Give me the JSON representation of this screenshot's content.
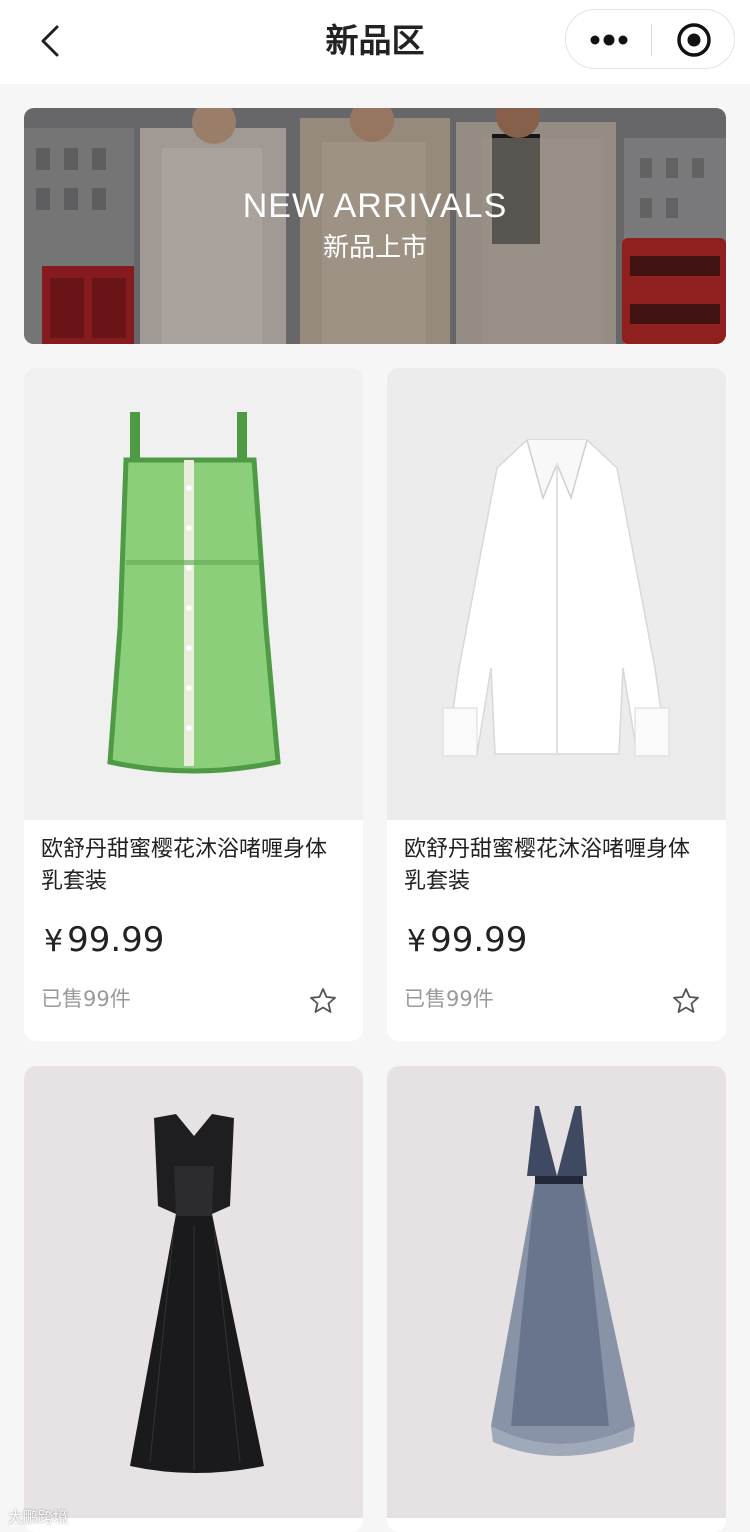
{
  "nav": {
    "title": "新品区"
  },
  "banner": {
    "title": "NEW ARRIVALS",
    "subtitle": "新品上市"
  },
  "products": [
    {
      "name": "欧舒丹甜蜜樱花沐浴啫喱身体乳套装",
      "currency": "¥",
      "price": "99.99",
      "sold": "已售99件",
      "image": "green-tweed-dress"
    },
    {
      "name": "欧舒丹甜蜜樱花沐浴啫喱身体乳套装",
      "currency": "¥",
      "price": "99.99",
      "sold": "已售99件",
      "image": "white-shirt"
    },
    {
      "image": "black-gown"
    },
    {
      "image": "navy-tulle-gown"
    }
  ],
  "watermark": "大鹏跨境",
  "colors": {
    "page_bg": "#f6f6f6",
    "card_bg": "#ffffff",
    "text_primary": "#222222",
    "text_muted": "#9a9a9a"
  }
}
